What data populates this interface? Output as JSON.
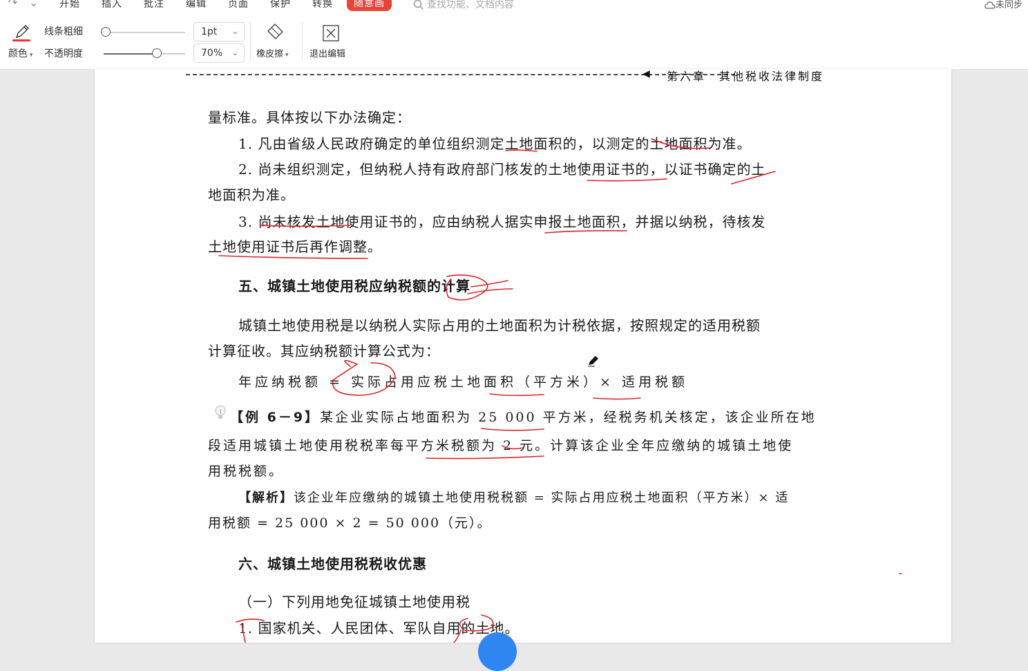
{
  "menubar": {
    "tabs": [
      {
        "label": "开始"
      },
      {
        "label": "插入"
      },
      {
        "label": "批注"
      },
      {
        "label": "编辑"
      },
      {
        "label": "页面"
      },
      {
        "label": "保护"
      },
      {
        "label": "转换"
      },
      {
        "label": "随意画"
      }
    ],
    "search_placeholder": "查找功能、文档内容",
    "sync_status": "未同步",
    "active_color": "#e4463b"
  },
  "toolbar": {
    "pen_label": "颜色",
    "line_width_label": "线条粗细",
    "opacity_label": "不透明度",
    "line_width_value": "1pt",
    "opacity_value": "70%",
    "opacity_level": 0.7,
    "line_width_level": 0.0,
    "eraser_label": "橡皮擦",
    "exit_label": "退出编辑",
    "pen_color": "#e33333"
  },
  "document": {
    "header": "第六章　其他税收法律制度",
    "lines": [
      "量标准。具体按以下办法确定：",
      "1. 凡由省级人民政府确定的单位组织测定土地面积的，以测定的土地面积为准。",
      "2. 尚未组织测定，但纳税人持有政府部门核发的土地使用证书的，以证书确定的土",
      "地面积为准。",
      "3. 尚未核发土地使用证书的，应由纳税人据实申报土地面积，并据以纳税，待核发",
      "土地使用证书后再作调整。",
      "五、城镇土地使用税应纳税额的计算",
      "城镇土地使用税是以纳税人实际占用的土地面积为计税依据，按照规定的适用税额",
      "计算征收。其应纳税额计算公式为：",
      "年应纳税额 = 实际占用应税土地面积（平方米）× 适用税额",
      "某企业实际占地面积为 25 000 平方米，经税务机关核定，该企业所在地",
      "段适用城镇土地使用税税率每平方米税额为 2 元。计算该企业全年应缴纳的城镇土地使",
      "用税税额。",
      "该企业年应缴纳的城镇土地使用税税额 = 实际占用应税土地面积（平方米）× 适",
      "用税额 = 25 000 × 2 = 50 000（元）。",
      "六、城镇土地使用税税收优惠",
      "（一）下列用地免征城镇土地使用税",
      "1. 国家机关、人民团体、军队自用的土地。"
    ],
    "example_tag": "【例 6－9】",
    "analysis_tag": "【解析】",
    "ink_color": "#d9252b"
  }
}
